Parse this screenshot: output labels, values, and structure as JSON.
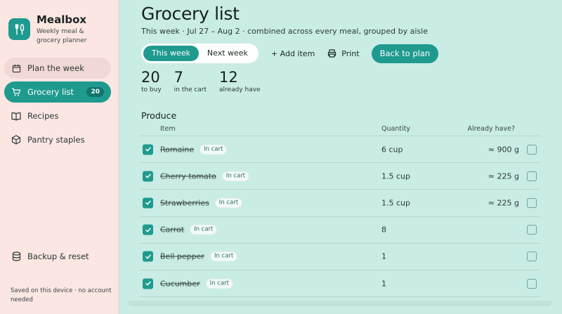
{
  "app": {
    "name": "Mealbox",
    "tagline": "Weekly meal & grocery planner",
    "saved_note": "Saved on this device · no account needed"
  },
  "sidebar": {
    "items": [
      {
        "label": "Plan the week",
        "icon": "calendar-icon"
      },
      {
        "label": "Grocery list",
        "icon": "cart-icon",
        "badge": "20"
      },
      {
        "label": "Recipes",
        "icon": "book-icon"
      },
      {
        "label": "Pantry staples",
        "icon": "box-icon"
      }
    ],
    "bottom_item": {
      "label": "Backup & reset",
      "icon": "database-icon"
    }
  },
  "page": {
    "title": "Grocery list",
    "subtitle": "This week · Jul 27 – Aug 2 · combined across every meal, grouped by aisle"
  },
  "toolbar": {
    "segments": [
      "This week",
      "Next week"
    ],
    "selected_segment": "This week",
    "add_item": "+ Add item",
    "print": "Print",
    "back": "Back to plan"
  },
  "stats": [
    {
      "value": "20",
      "label": "to buy"
    },
    {
      "value": "7",
      "label": "in the cart"
    },
    {
      "value": "12",
      "label": "already have"
    }
  ],
  "section": {
    "title": "Produce",
    "columns": {
      "item": "Item",
      "quantity": "Quantity",
      "have": "Already have?"
    },
    "rows": [
      {
        "name": "Romaine",
        "pill": "In cart",
        "qty": "6 cup",
        "have": "≈ 900 g",
        "checked": true,
        "have_checked": false
      },
      {
        "name": "Cherry tomato",
        "pill": "In cart",
        "qty": "1.5 cup",
        "have": "≈ 225 g",
        "checked": true,
        "have_checked": false
      },
      {
        "name": "Strawberries",
        "pill": "In cart",
        "qty": "1.5 cup",
        "have": "≈ 225 g",
        "checked": true,
        "have_checked": false
      },
      {
        "name": "Carrot",
        "pill": "In cart",
        "qty": "8",
        "have": "",
        "checked": true,
        "have_checked": false
      },
      {
        "name": "Bell pepper",
        "pill": "In cart",
        "qty": "1",
        "have": "",
        "checked": true,
        "have_checked": false
      },
      {
        "name": "Cucumber",
        "pill": "In cart",
        "qty": "1",
        "have": "",
        "checked": true,
        "have_checked": false
      }
    ]
  },
  "colors": {
    "accent": "#1f9a8f",
    "sidebar_bg": "#fbe6e2",
    "main_bg": "#c9ece4"
  }
}
